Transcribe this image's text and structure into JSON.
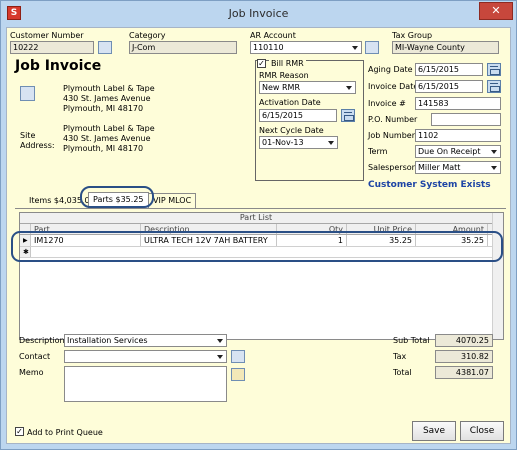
{
  "window": {
    "title": "Job Invoice",
    "close_glyph": "✕"
  },
  "header": {
    "customer_number_label": "Customer Number",
    "customer_number": "10222",
    "category_label": "Category",
    "category": "J-Com",
    "ar_account_label": "AR Account",
    "ar_account": "110110",
    "tax_group_label": "Tax Group",
    "tax_group": "MI-Wayne County"
  },
  "main": {
    "heading": "Job Invoice",
    "bill_to": {
      "name": "Plymouth Label & Tape",
      "street": "430 St. James Avenue",
      "city": "Plymouth, MI  48170"
    },
    "site_label_1": "Site",
    "site_label_2": "Address:",
    "site": {
      "name": "Plymouth Label & Tape",
      "street": "430 St. James Avenue",
      "city": "Plymouth, MI  48170"
    }
  },
  "rmr": {
    "bill_rmr_label": "Bill RMR",
    "bill_rmr_checked": "✓",
    "rmr_reason_label": "RMR Reason",
    "rmr_reason": "New RMR",
    "activation_date_label": "Activation Date",
    "activation_date": "6/15/2015",
    "next_cycle_label": "Next Cycle Date",
    "next_cycle": "01-Nov-13"
  },
  "details": {
    "aging_date_label": "Aging Date",
    "aging_date": "6/15/2015",
    "invoice_date_label": "Invoice Date",
    "invoice_date": "6/15/2015",
    "invoice_num_label": "Invoice #",
    "invoice_num": "141583",
    "po_label": "P.O. Number",
    "po": "",
    "job_number_label": "Job Number",
    "job_number": "1102",
    "term_label": "Term",
    "term": "Due On Receipt",
    "salesperson_label": "Salesperson",
    "salesperson": "Miller Matt",
    "customer_system_link": "Customer System Exists"
  },
  "tabs": [
    {
      "label": "Items  $4,035.00"
    },
    {
      "label": "Parts  $35.25"
    },
    {
      "label": "VIP MLOC"
    }
  ],
  "grid": {
    "title": "Part List",
    "columns": [
      "Part",
      "Description",
      "Qty",
      "Unit Price",
      "Amount"
    ],
    "rows": [
      {
        "part": "IM1270",
        "description": "ULTRA TECH 12V 7AH BATTERY",
        "qty": "1",
        "unit_price": "35.25",
        "amount": "35.25"
      }
    ],
    "current_row_glyph": "▶",
    "new_row_glyph": "✱"
  },
  "bottom": {
    "description_label": "Description",
    "description": "Installation Services",
    "contact_label": "Contact",
    "contact": "",
    "memo_label": "Memo",
    "sub_total_label": "Sub Total",
    "sub_total": "4070.25",
    "tax_label": "Tax",
    "tax": "310.82",
    "total_label": "Total",
    "total": "4381.07",
    "add_to_queue_label": "Add to Print Queue",
    "add_to_queue_checked": "✓",
    "save_label": "Save",
    "close_label": "Close"
  },
  "colors": {
    "window_frame": "#bcd6ef",
    "client_bg": "#fefdd9",
    "highlight": "#2a4f86",
    "link": "#1d44a5"
  }
}
